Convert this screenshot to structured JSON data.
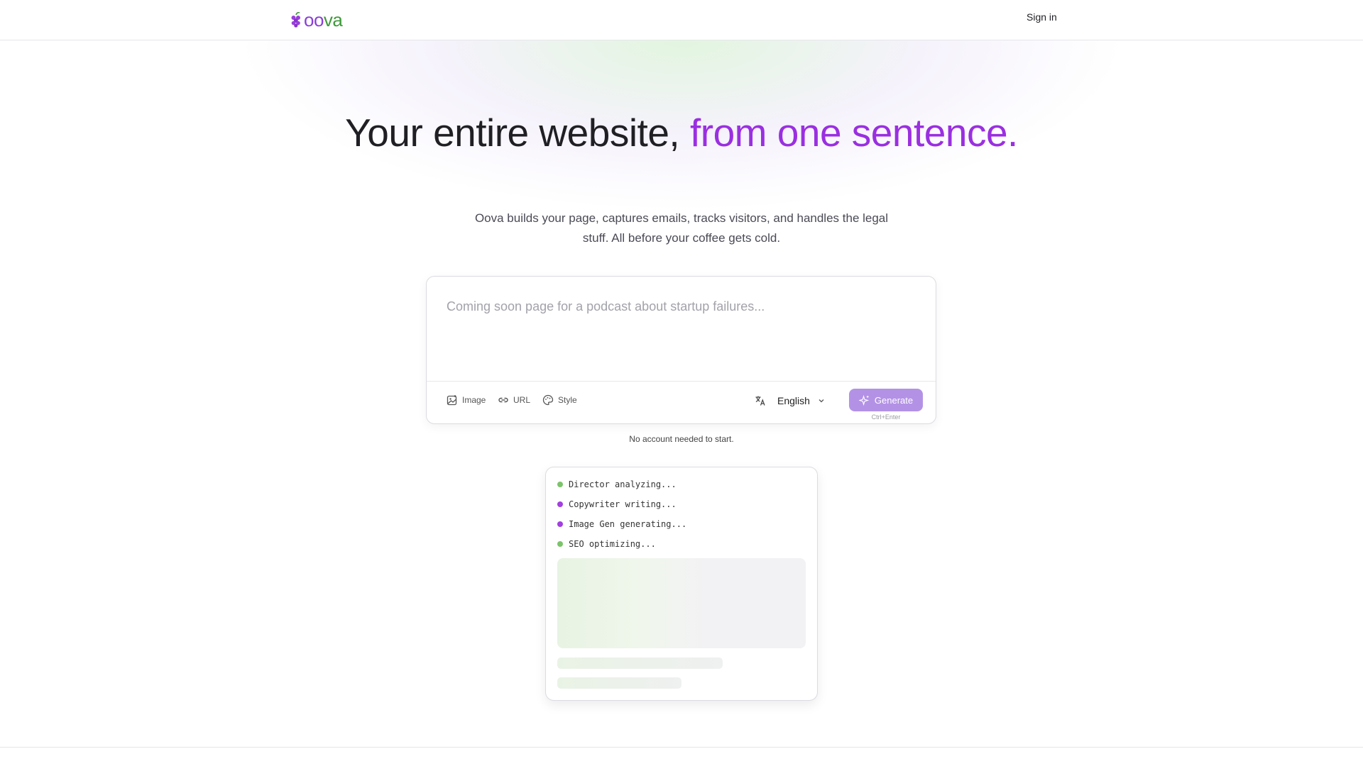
{
  "header": {
    "logo_text_part1": "oo",
    "logo_text_part2": "va",
    "signin_label": "Sign in"
  },
  "hero": {
    "title_plain": "Your entire website,",
    "title_accent": "from one sentence.",
    "subtitle": "Oova builds your page, captures emails, tracks visitors, and handles the legal stuff. All before your coffee gets cold."
  },
  "prompt": {
    "placeholder": "Coming soon page for a podcast about startup failures...",
    "value": "",
    "tools": {
      "image": "Image",
      "url": "URL",
      "style": "Style"
    },
    "language": "English",
    "generate_label": "Generate",
    "shortcut": "Ctrl+Enter"
  },
  "note": "No account needed to start.",
  "agents": [
    {
      "label": "Director analyzing...",
      "color": "#7cc46a"
    },
    {
      "label": "Copywriter writing...",
      "color": "#a23fe0"
    },
    {
      "label": "Image Gen generating...",
      "color": "#a23fe0"
    },
    {
      "label": "SEO optimizing...",
      "color": "#7cc46a"
    }
  ],
  "colors": {
    "accent_purple": "#9a2fe0",
    "brand_green": "#3f9a3a",
    "generate_button": "#b392e6"
  }
}
